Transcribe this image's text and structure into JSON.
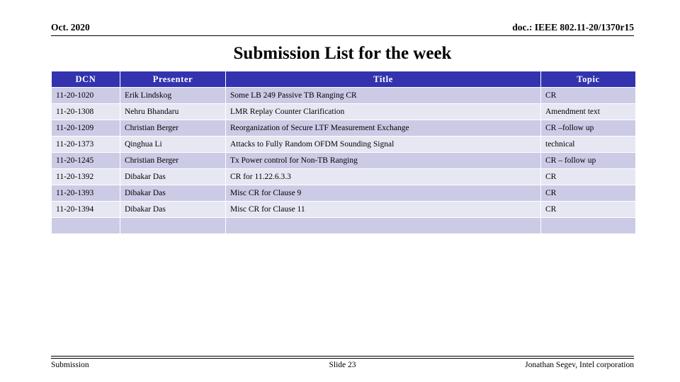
{
  "header": {
    "date": "Oct. 2020",
    "doc_id": "doc.: IEEE 802.11-20/1370r15"
  },
  "title": "Submission List for the week",
  "table": {
    "columns": [
      "DCN",
      "Presenter",
      "Title",
      "Topic"
    ],
    "rows": [
      {
        "dcn": "11-20-1020",
        "presenter": "Erik Lindskog",
        "title": "Some LB 249 Passive TB Ranging CR",
        "topic": "CR"
      },
      {
        "dcn": "11-20-1308",
        "presenter": "Nehru Bhandaru",
        "title": "LMR Replay Counter Clarification",
        "topic": "Amendment text"
      },
      {
        "dcn": "11-20-1209",
        "presenter": "Christian Berger",
        "title": "Reorganization of Secure LTF Measurement Exchange",
        "topic": "CR –follow up"
      },
      {
        "dcn": "11-20-1373",
        "presenter": "Qinghua Li",
        "title": "Attacks to Fully Random OFDM Sounding Signal",
        "topic": "technical"
      },
      {
        "dcn": "11-20-1245",
        "presenter": "Christian Berger",
        "title": "Tx Power control for Non-TB Ranging",
        "topic": "CR – follow up"
      },
      {
        "dcn": "11-20-1392",
        "presenter": "Dibakar Das",
        "title": "CR for 11.22.6.3.3",
        "topic": "CR"
      },
      {
        "dcn": "11-20-1393",
        "presenter": "Dibakar Das",
        "title": "Misc CR for Clause 9",
        "topic": "CR"
      },
      {
        "dcn": "11-20-1394",
        "presenter": "Dibakar Das",
        "title": "Misc CR for Clause 11",
        "topic": "CR"
      },
      {
        "dcn": "",
        "presenter": "",
        "title": "",
        "topic": ""
      }
    ]
  },
  "footer": {
    "left": "Submission",
    "center": "Slide 23",
    "right": "Jonathan Segev, Intel corporation"
  },
  "colors": {
    "header_blue": "#3333B0",
    "row_dark": "#CBCBE6",
    "row_light": "#E7E7F4",
    "text": "#000000"
  }
}
